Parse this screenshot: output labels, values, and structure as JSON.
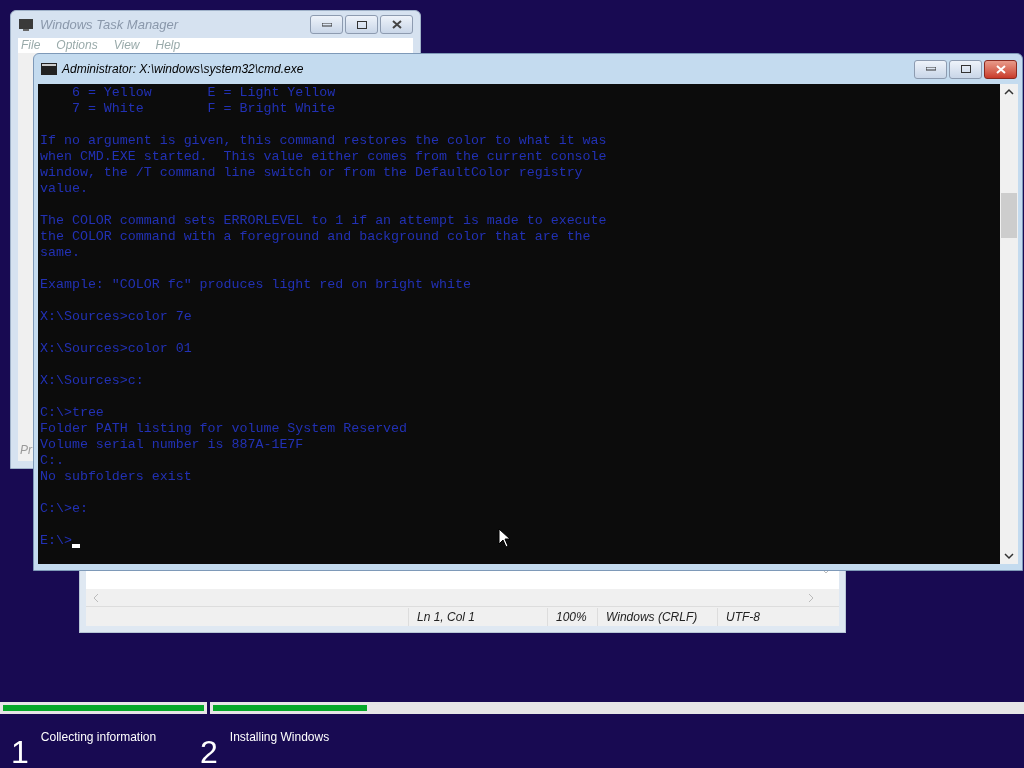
{
  "task_manager": {
    "title": "Windows Task Manager",
    "menu": [
      "File",
      "Options",
      "View",
      "Help"
    ],
    "tab_partial": "Pr"
  },
  "cmd": {
    "title": "Administrator: X:\\windows\\system32\\cmd.exe",
    "blocks": [
      [
        "    6 = Yellow       E = Light Yellow",
        "    7 = White        F = Bright White"
      ],
      [
        "If no argument is given, this command restores the color to what it was",
        "when CMD.EXE started.  This value either comes from the current console",
        "window, the /T command line switch or from the DefaultColor registry",
        "value."
      ],
      [
        "The COLOR command sets ERRORLEVEL to 1 if an attempt is made to execute",
        "the COLOR command with a foreground and background color that are the",
        "same."
      ],
      [
        "Example: \"COLOR fc\" produces light red on bright white"
      ],
      [
        "X:\\Sources>color 7e"
      ],
      [
        "X:\\Sources>color 01"
      ],
      [
        "X:\\Sources>c:"
      ],
      [
        "C:\\>tree",
        "Folder PATH listing for volume System Reserved",
        "Volume serial number is 887A-1E7F",
        "C:.",
        "No subfolders exist"
      ],
      [
        "C:\\>e:"
      ],
      [
        "E:\\>"
      ]
    ]
  },
  "notepad": {
    "status": [
      "Ln 1, Col 1",
      "100%",
      "Windows (CRLF)",
      "UTF-8"
    ]
  },
  "setup": {
    "steps": [
      {
        "number": "1",
        "label": "Collecting information",
        "level": 1
      },
      {
        "number": "2",
        "label": "Installing Windows",
        "level": 0.19
      }
    ]
  }
}
